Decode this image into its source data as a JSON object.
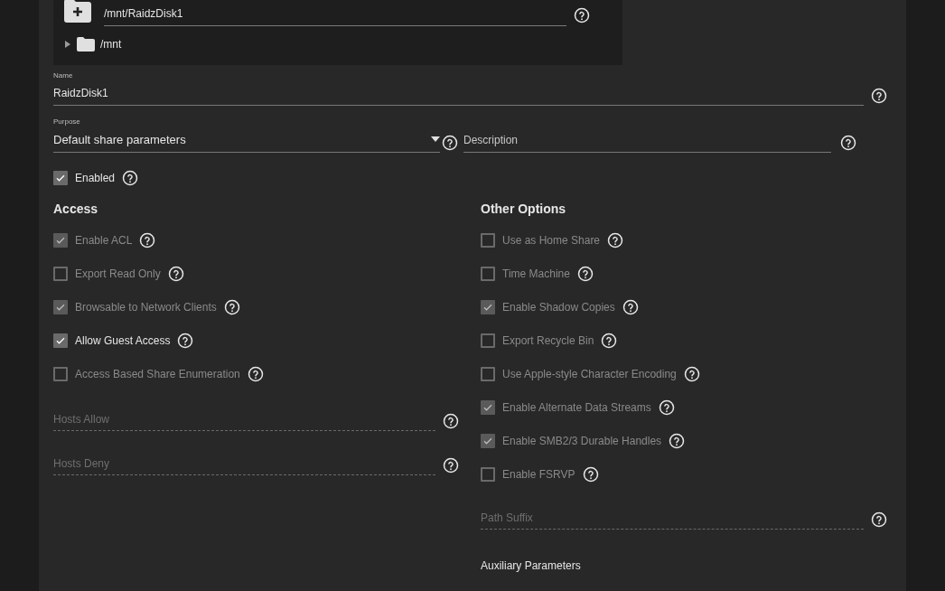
{
  "path_picker": {
    "value": "/mnt/RaidzDisk1",
    "tree": [
      {
        "label": "/mnt",
        "expanded": false
      }
    ]
  },
  "name_field": {
    "label": "Name",
    "value": "RaidzDisk1"
  },
  "purpose_field": {
    "label": "Purpose",
    "value": "Default share parameters"
  },
  "description_field": {
    "placeholder": "Description"
  },
  "enabled": {
    "label": "Enabled",
    "checked": true,
    "disabled": false
  },
  "access": {
    "title": "Access",
    "options": [
      {
        "label": "Enable ACL",
        "checked": true,
        "disabled": true
      },
      {
        "label": "Export Read Only",
        "checked": false,
        "disabled": true
      },
      {
        "label": "Browsable to Network Clients",
        "checked": true,
        "disabled": true
      },
      {
        "label": "Allow Guest Access",
        "checked": true,
        "disabled": false
      },
      {
        "label": "Access Based Share Enumeration",
        "checked": false,
        "disabled": true
      }
    ],
    "fields": [
      {
        "placeholder": "Hosts Allow"
      },
      {
        "placeholder": "Hosts Deny"
      }
    ]
  },
  "other_options": {
    "title": "Other Options",
    "options": [
      {
        "label": "Use as Home Share",
        "checked": false,
        "disabled": true
      },
      {
        "label": "Time Machine",
        "checked": false,
        "disabled": true
      },
      {
        "label": "Enable Shadow Copies",
        "checked": true,
        "disabled": true
      },
      {
        "label": "Export Recycle Bin",
        "checked": false,
        "disabled": true
      },
      {
        "label": "Use Apple-style Character Encoding",
        "checked": false,
        "disabled": true
      },
      {
        "label": "Enable Alternate Data Streams",
        "checked": true,
        "disabled": true
      },
      {
        "label": "Enable SMB2/3 Durable Handles",
        "checked": true,
        "disabled": true
      },
      {
        "label": "Enable FSRVP",
        "checked": false,
        "disabled": true
      }
    ],
    "fields": [
      {
        "placeholder": "Path Suffix"
      }
    ],
    "auxiliary_label": "Auxiliary Parameters"
  }
}
